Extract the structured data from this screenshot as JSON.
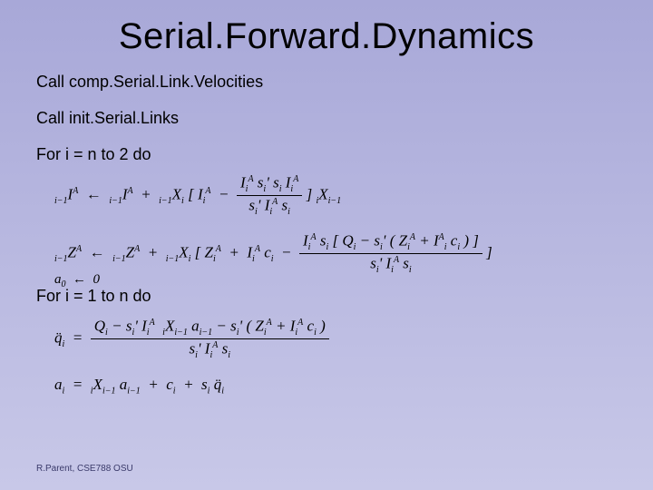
{
  "title": "Serial.Forward.Dynamics",
  "lines": {
    "call1": "Call comp.Serial.Link.Velocities",
    "call2": "Call init.Serial.Links",
    "loop1": "For i = n to 2 do",
    "loop2": "For i = 1 to n do"
  },
  "equations": {
    "eq1": {
      "lhs_pre_sub": "i−1",
      "lhs": "I",
      "lhs_sup": "A",
      "arrow": "←",
      "t1_pre_sub": "i−1",
      "t1": "I",
      "t1_sup": "A",
      "plus": "+",
      "t2_pre_sub": "i−1",
      "t2": "X",
      "t2_post_sub": "i",
      "open": "[",
      "t3": "I",
      "t3_post_sub": "i",
      "t3_sup": "A",
      "minus": "−",
      "frac_num_a": "I",
      "frac_num_a_sub": "i",
      "frac_num_a_sup": "A",
      "frac_num_b": "s",
      "frac_num_b_sub": "i",
      "frac_num_b_t": "'",
      "frac_num_c": "s",
      "frac_num_c_sub": "i",
      "frac_num_d": "I",
      "frac_num_d_sub": "i",
      "frac_num_d_sup": "A",
      "frac_den_a": "s",
      "frac_den_a_sub": "i",
      "frac_den_a_t": "'",
      "frac_den_b": "I",
      "frac_den_b_sub": "i",
      "frac_den_b_sup": "A",
      "frac_den_c": "s",
      "frac_den_c_sub": "i",
      "close": "]",
      "t4_pre_sub": "i",
      "t4": "X",
      "t4_post_sub": "i−1"
    },
    "eq2": {
      "lhs_pre_sub": "i−1",
      "lhs": "Z",
      "lhs_sup": "A",
      "arrow": "←",
      "t1_pre_sub": "i−1",
      "t1": "Z",
      "t1_sup": "A",
      "plus": "+",
      "t2_pre_sub": "i−1",
      "t2": "X",
      "t2_post_sub": "i",
      "open": "[",
      "t3": "Z",
      "t3_post_sub": "i",
      "t3_sup": "A",
      "plus2": "+",
      "t4": "I",
      "t4_post_sub": "i",
      "t4_sup": "A",
      "t5": "c",
      "t5_post_sub": "i",
      "minus": "−",
      "frac_num_a": "I",
      "frac_num_a_sub": "i",
      "frac_num_a_sup": "A",
      "frac_num_b": "s",
      "frac_num_b_sub": "i",
      "open2": "[",
      "frac_num_c": "Q",
      "frac_num_c_sub": "i",
      "minus2": "−",
      "frac_num_d": "s",
      "frac_num_d_sub": "i",
      "frac_num_d_t": "'",
      "open3": "(",
      "frac_num_e": "Z",
      "frac_num_e_sub": "i",
      "frac_num_e_sup": "A",
      "plus3": "+",
      "frac_num_f": "I",
      "frac_num_f_sup": "A",
      "frac_num_f_sub": "i",
      "frac_num_g": "c",
      "frac_num_g_sub": "i",
      "close3": ")",
      "close2": "]",
      "frac_den_a": "s",
      "frac_den_a_sub": "i",
      "frac_den_a_t": "'",
      "frac_den_b": "I",
      "frac_den_b_sub": "i",
      "frac_den_b_sup": "A",
      "frac_den_c": "s",
      "frac_den_c_sub": "i",
      "close": "]"
    },
    "eq3": {
      "lhs": "q̈",
      "lhs_sub": "i",
      "eq": "=",
      "frac_num_a": "Q",
      "frac_num_a_sub": "i",
      "minus": "−",
      "frac_num_b": "s",
      "frac_num_b_sub": "i",
      "frac_num_b_t": "'",
      "frac_num_c": "I",
      "frac_num_c_sub": "i",
      "frac_num_c_sup": "A",
      "frac_num_d_pre_sub": "i",
      "frac_num_d": "X",
      "frac_num_d_sub": "i−1",
      "frac_num_e": "a",
      "frac_num_e_sub": "i−1",
      "minus2": "−",
      "frac_num_f": "s",
      "frac_num_f_sub": "i",
      "frac_num_f_t": "'",
      "open": "(",
      "frac_num_g": "Z",
      "frac_num_g_sub": "i",
      "frac_num_g_sup": "A",
      "plus": "+",
      "frac_num_h": "I",
      "frac_num_h_sub": "i",
      "frac_num_h_sup": "A",
      "frac_num_i": "c",
      "frac_num_i_sub": "i",
      "close": ")",
      "frac_den_a": "s",
      "frac_den_a_sub": "i",
      "frac_den_a_t": "'",
      "frac_den_b": "I",
      "frac_den_b_sub": "i",
      "frac_den_b_sup": "A",
      "frac_den_c": "s",
      "frac_den_c_sub": "i"
    },
    "eq4": {
      "lhs": "a",
      "lhs_sub": "i",
      "eq": "=",
      "t1_pre_sub": "i",
      "t1": "X",
      "t1_post_sub": "i−1",
      "t2": "a",
      "t2_sub": "i−1",
      "plus": "+",
      "t3": "c",
      "t3_sub": "i",
      "plus2": "+",
      "t4": "s",
      "t4_sub": "i",
      "t5": "q̈",
      "t5_sub": "i"
    },
    "init": {
      "lhs": "a",
      "lhs_sub": "0",
      "arrow": "←",
      "rhs": "0"
    }
  },
  "footer": "R.Parent, CSE788 OSU"
}
